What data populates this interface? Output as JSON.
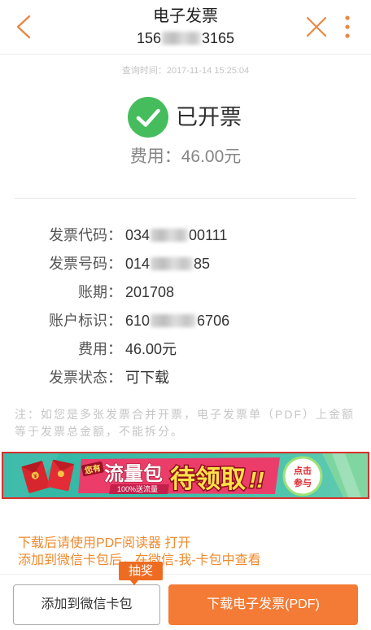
{
  "header": {
    "title": "电子发票",
    "phone_prefix": "156",
    "phone_suffix": "3165",
    "back_icon": "chevron-left-icon",
    "close_icon": "close-icon",
    "more_icon": "more-vertical-icon"
  },
  "query_time": "查询时间：2017-11-14 15:25:04",
  "status": {
    "icon": "check-circle-icon",
    "text": "已开票"
  },
  "fee_summary": "费用：46.00元",
  "details": [
    {
      "label": "发票代码：",
      "value_prefix": "034",
      "masked": true,
      "value_suffix": "00111"
    },
    {
      "label": "发票号码：",
      "value_prefix": "014",
      "masked": true,
      "value_suffix": "85"
    },
    {
      "label": "账期：",
      "value": "201708"
    },
    {
      "label": "账户标识：",
      "value_prefix": "610",
      "masked": true,
      "value_suffix": "6706"
    },
    {
      "label": "费用：",
      "value": "46.00元"
    },
    {
      "label": "发票状态：",
      "value": "可下载"
    }
  ],
  "note_lines": [
    "注：如您是多张发票合并开票，电子发票单（PDF）上金额",
    "等于发票总金额，不能拆分。"
  ],
  "banner": {
    "envelope_icon": "red-envelope-icon",
    "tag": "您有",
    "headline": "流量包",
    "subline": "100%送流量",
    "highlight": "待领取",
    "exclaim": "!!",
    "cta": [
      "点击",
      "参与"
    ]
  },
  "tips": [
    "下载后请使用PDF阅读器 打开",
    "添加到微信卡包后，在微信-我-卡包中查看"
  ],
  "badge": "抽奖",
  "buttons": {
    "add_to_wechat": "添加到微信卡包",
    "download_pdf": "下载电子发票(PDF)"
  },
  "colors": {
    "accent_orange": "#F47B35",
    "tip_orange": "#EF8A2E",
    "icon_orange": "#E98845",
    "success_green": "#45BD5C",
    "banner_border": "#D9302C",
    "banner_teal": "#35BBA7"
  }
}
